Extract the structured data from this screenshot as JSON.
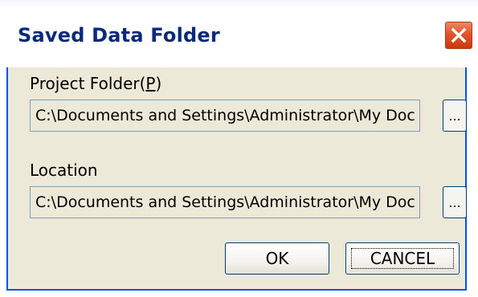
{
  "window": {
    "title": "Saved Data Folder",
    "title_color": "#0b2a7c",
    "close_icon": "close-icon"
  },
  "project_folder": {
    "label": "Project Folder(",
    "mnemonic": "P",
    "label_suffix": ")",
    "value": "C:\\Documents and Settings\\Administrator\\My Doc",
    "browse_label": "..."
  },
  "location": {
    "label": "Location",
    "value": "C:\\Documents and Settings\\Administrator\\My Doc",
    "browse_label": "..."
  },
  "buttons": {
    "ok_label": "OK",
    "cancel_label": "CANCEL"
  },
  "colors": {
    "dialog_background": "#ece9d8",
    "close_button": "#e2542b",
    "border": "#0055e5"
  }
}
